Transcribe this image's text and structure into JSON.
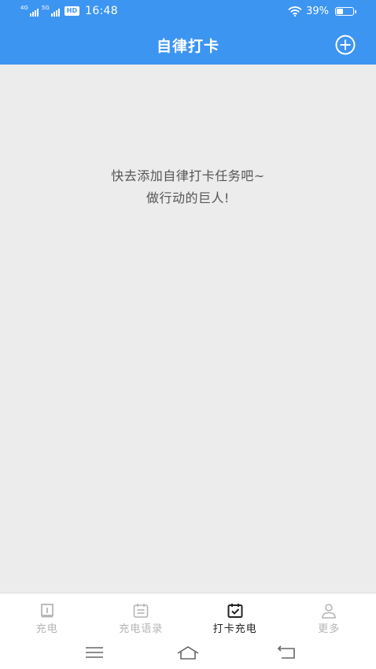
{
  "status_bar": {
    "net1": "4G",
    "net2": "5G",
    "hd": "HD",
    "time": "16:48",
    "battery": "39%"
  },
  "header": {
    "title": "自律打卡"
  },
  "empty_state": {
    "line1": "快去添加自律打卡任务吧~",
    "line2": "做行动的巨人!"
  },
  "tabs": [
    {
      "label": "充电",
      "icon": "charge-icon",
      "active": false
    },
    {
      "label": "充电语录",
      "icon": "calendar-list-icon",
      "active": false
    },
    {
      "label": "打卡充电",
      "icon": "calendar-check-icon",
      "active": true
    },
    {
      "label": "更多",
      "icon": "person-icon",
      "active": false
    }
  ],
  "colors": {
    "primary": "#3d95f2",
    "background": "#ececec",
    "tab_active": "#222222",
    "tab_inactive": "#b4b4b4"
  }
}
